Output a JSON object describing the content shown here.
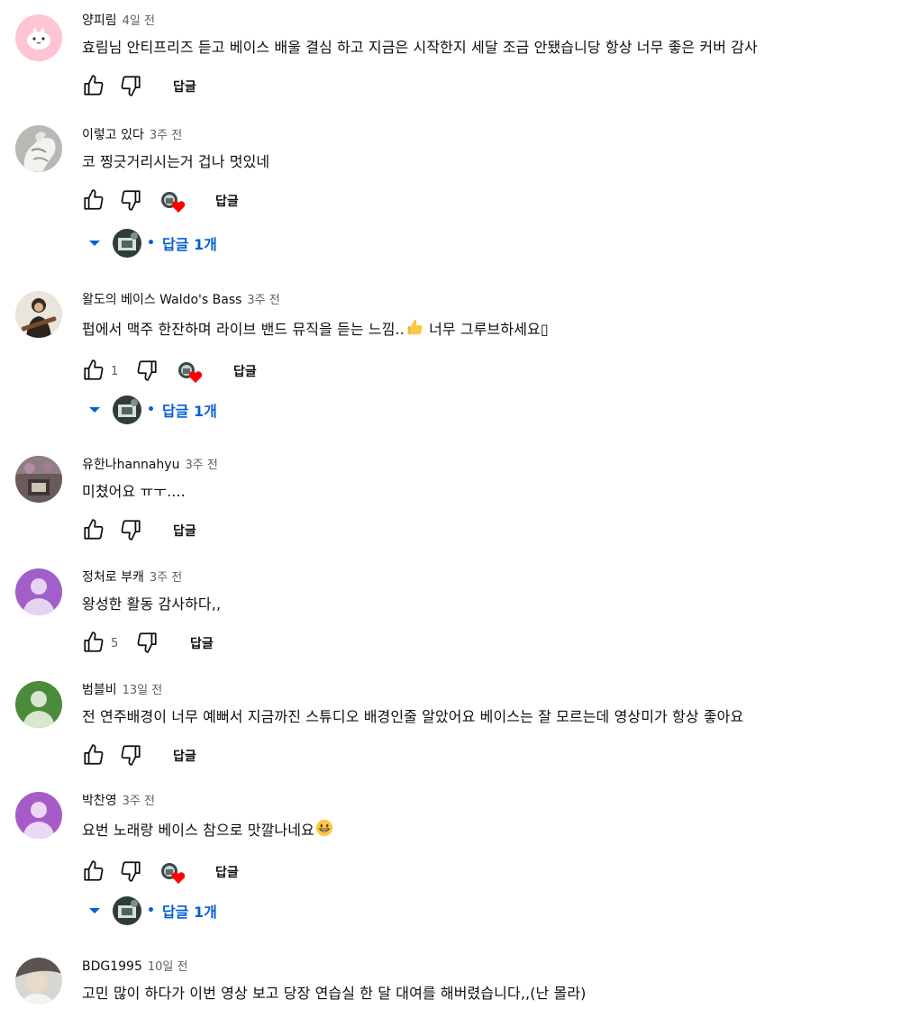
{
  "reply_label": "답글",
  "comments": [
    {
      "author": "양피림",
      "time": "4일 전",
      "text": "효림님 안티프리즈 듣고 베이스 배울 결심 하고 지금은 시작한지 세달 조금 안됐습니당 항상 너무 좋은 커버 감사",
      "like_count": "",
      "creator_heart": false,
      "replies": ""
    },
    {
      "author": "이렇고 있다",
      "time": "3주 전",
      "text": "코 찡긋거리시는거 겁나 멋있네",
      "like_count": "",
      "creator_heart": true,
      "replies": "답글 1개"
    },
    {
      "author": "왈도의 베이스 Waldo's Bass",
      "time": "3주 전",
      "text_before": "펍에서 맥주 한잔하며 라이브 밴드 뮤직을 듣는 느낌..",
      "text_after": " 너무 그루브하세요▯",
      "like_count": "1",
      "creator_heart": true,
      "replies": "답글 1개"
    },
    {
      "author": "유한나hannahyu",
      "time": "3주 전",
      "text": "미쳤어요 ㅠㅜ....",
      "like_count": "",
      "creator_heart": false,
      "replies": ""
    },
    {
      "author": "정처로 부캐",
      "time": "3주 전",
      "text": "왕성한 활동 감사하다,,",
      "like_count": "5",
      "creator_heart": false,
      "replies": ""
    },
    {
      "author": "범블비",
      "time": "13일 전",
      "text": "전 연주배경이 너무 예뻐서 지금까진 스튜디오 배경인줄 알았어요 베이스는 잘 모르는데 영상미가 항상 좋아요",
      "like_count": "",
      "creator_heart": false,
      "replies": ""
    },
    {
      "author": "박찬영",
      "time": "3주 전",
      "text": "요번 노래랑 베이스 참으로 맛깔나네요",
      "like_count": "",
      "creator_heart": true,
      "replies": "답글 1개"
    },
    {
      "author": "BDG1995",
      "time": "10일 전",
      "text": "고민 많이 하다가 이번 영상 보고 당장 연습실 한 달 대여를 해버렸습니다,,(난 몰라)",
      "like_count": "",
      "creator_heart": false,
      "replies": ""
    }
  ],
  "colors": {
    "link_blue": "#065fd4",
    "meta_gray": "#606060",
    "heart_red": "#ff0000",
    "default_avatar_purple": "#a05fc9",
    "default_avatar_green": "#4b8b3b"
  }
}
